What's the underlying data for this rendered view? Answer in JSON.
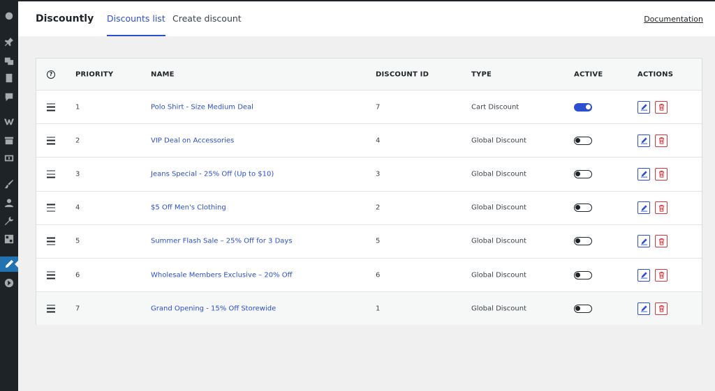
{
  "header": {
    "brand": "Discountly",
    "tabs": [
      {
        "label": "Discounts list",
        "active": true
      },
      {
        "label": "Create discount",
        "active": false
      }
    ],
    "documentation_label": "Documentation"
  },
  "table": {
    "columns": [
      "PRIORITY",
      "NAME",
      "DISCOUNT ID",
      "TYPE",
      "ACTIVE",
      "ACTIONS"
    ],
    "help_glyph": "?",
    "rows": [
      {
        "priority": "1",
        "name": "Polo Shirt - Size Medium Deal",
        "discount_id": "7",
        "type": "Cart Discount",
        "active": true
      },
      {
        "priority": "2",
        "name": "VIP Deal on Accessories",
        "discount_id": "4",
        "type": "Global Discount",
        "active": false
      },
      {
        "priority": "3",
        "name": "Jeans Special - 25% Off (Up to $10)",
        "discount_id": "3",
        "type": "Global Discount",
        "active": false
      },
      {
        "priority": "4",
        "name": "$5 Off Men's Clothing",
        "discount_id": "2",
        "type": "Global Discount",
        "active": false
      },
      {
        "priority": "5",
        "name": "Summer Flash Sale – 25% Off for 3 Days",
        "discount_id": "5",
        "type": "Global Discount",
        "active": false
      },
      {
        "priority": "6",
        "name": "Wholesale Members Exclusive – 20% Off",
        "discount_id": "6",
        "type": "Global Discount",
        "active": false
      },
      {
        "priority": "7",
        "name": "Grand Opening - 15% Off Storewide",
        "discount_id": "1",
        "type": "Global Discount",
        "active": false
      }
    ]
  },
  "sidebar": {
    "icons": [
      "dashboard-icon",
      "pin-icon",
      "media-icon",
      "pages-icon",
      "comments-icon",
      "woocommerce-icon",
      "products-icon",
      "payments-icon",
      "appearance-icon",
      "users-icon",
      "tools-icon",
      "settings-icon",
      "discountly-icon",
      "collapse-icon"
    ]
  },
  "colors": {
    "accent": "#2c4fcf",
    "danger": "#d63638",
    "sidebar_bg": "#1d2327",
    "page_bg": "#f0f0f1"
  }
}
